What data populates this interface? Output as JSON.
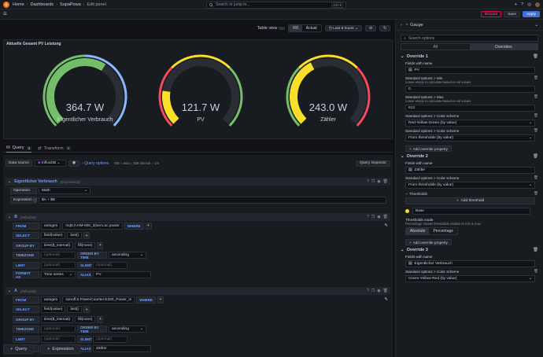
{
  "nav": {
    "breadcrumbs": [
      "Home",
      "Dashboards",
      "SupaPowa",
      "Edit panel"
    ],
    "search_placeholder": "Search or jump to...",
    "search_shortcut": "ctrl+k"
  },
  "toolbar": {
    "discard": "Discard",
    "save": "Save",
    "apply": "Apply"
  },
  "view": {
    "table_view": "Table view",
    "fill": "Fill",
    "actual": "Actual",
    "time_range": "Last 9 hours"
  },
  "panel": {
    "title": "Aktuelle Gesamt PV Leistung",
    "gauges": [
      {
        "value_text": "364.7 W",
        "label": "Eigentlicher Verbrauch",
        "fraction": 0.62,
        "value_color": "#73bf69",
        "scheme_colors": [
          "#73bf69",
          "#8ab8ff"
        ]
      },
      {
        "value_text": "121.7 W",
        "label": "PV",
        "fraction": 0.2,
        "value_color": "#fade2a",
        "scheme_colors": [
          "#f2495c",
          "#fade2a",
          "#73bf69"
        ]
      },
      {
        "value_text": "243.0 W",
        "label": "Zähler",
        "fraction": 0.4,
        "value_color": "#fade2a",
        "scheme_colors": [
          "#73bf69",
          "#fade2a",
          "#f2495c"
        ]
      }
    ]
  },
  "query_tabs": {
    "query": "Query",
    "query_count": "3",
    "transform": "Transform",
    "transform_count": "0"
  },
  "datasource": {
    "label": "Data source",
    "name": "InfluxDB",
    "query_options": "Query options",
    "meta": "MD = auto = 838   Interval = 1m",
    "inspector": "Query inspector"
  },
  "queries": {
    "expr": {
      "ref": "Eigentlicher Verbrauch",
      "kind": "(Expression)",
      "operation_label": "Operation",
      "operation": "Math",
      "expression_label": "Expression",
      "expression": "$A + $B"
    },
    "b": {
      "ref": "B",
      "kind": "(InfluxDB)",
      "from": "FROM",
      "policy": "autogen",
      "measurement": "mqtt.0.HM-600_3(sem.ac.power",
      "where": "WHERE",
      "select": "SELECT",
      "field": "field(value)",
      "agg": "last()",
      "group_by": "GROUP BY",
      "time": "time($_interval)",
      "fill": "fill(none)",
      "timezone": "TIMEZONE",
      "tz_ph": "(optional)",
      "order": "ORDER BY TIME",
      "order_val": "ascending",
      "limit": "LIMIT",
      "limit_ph": "(optional)",
      "slimit": "SLIMIT",
      "slimit_ph": "(optional)",
      "format": "FORMAT AS",
      "format_val": "Time series",
      "alias": "ALIAS",
      "alias_val": "PV"
    },
    "a": {
      "ref": "A",
      "kind": "(InfluxDB)",
      "from": "FROM",
      "policy": "autogen",
      "measurement": "sonoff.0.PowerCounter.E320_Power_in",
      "where": "WHERE",
      "select": "SELECT",
      "field": "field(value)",
      "agg": "last()",
      "group_by": "GROUP BY",
      "time": "time($_interval)",
      "fill": "fill(none)",
      "timezone": "TIMEZONE",
      "tz_ph": "(optional)",
      "order": "ORDER BY TIME",
      "order_val": "ascending",
      "limit": "LIMIT",
      "limit_ph": "(optional)",
      "slimit": "SLIMIT",
      "slimit_ph": "(optional)",
      "format": "FORMAT AS",
      "format_val": "Time series",
      "alias": "ALIAS",
      "alias_val": "Zähler"
    }
  },
  "bottom": {
    "add_query": "Query",
    "add_expression": "Expression"
  },
  "right": {
    "viz": "Gauge",
    "search_placeholder": "Search options",
    "tab_all": "All",
    "tab_overrides": "Overrides",
    "o1": {
      "title": "Override 1",
      "fields_label": "Fields with name",
      "fields_val": "PV",
      "min_label": "Standard options > Min",
      "min_desc": "Leave empty to calculate based on all values",
      "min_val": "0",
      "max_label": "Standard options > Max",
      "max_desc": "Leave empty to calculate based on all values",
      "max_val": "612",
      "cs_label": "Standard options > Color scheme",
      "cs_val": "Red-Yellow-Green (by value)",
      "cs2_label": "Standard options > Color scheme",
      "cs2_val": "From thresholds (by value)",
      "add_prop": "Add override property"
    },
    "o2": {
      "title": "Override 2",
      "fields_label": "Fields with name",
      "fields_val": "Zähler",
      "cs_label": "Standard options > Color scheme",
      "cs_val": "From thresholds (by value)",
      "thr_label": "Thresholds",
      "add_thr": "Add threshold",
      "base": "Base",
      "mode_label": "Thresholds mode",
      "mode_desc": "Percentage means thresholds relative to min & max",
      "absolute": "Absolute",
      "percentage": "Percentage",
      "add_prop": "Add override property"
    },
    "o3": {
      "title": "Override 3",
      "fields_label": "Fields with name",
      "fields_val": "Eigentlicher Verbrauch",
      "cs_label": "Standard options > Color scheme",
      "cs_val": "Green-Yellow-Red (by value)"
    }
  }
}
